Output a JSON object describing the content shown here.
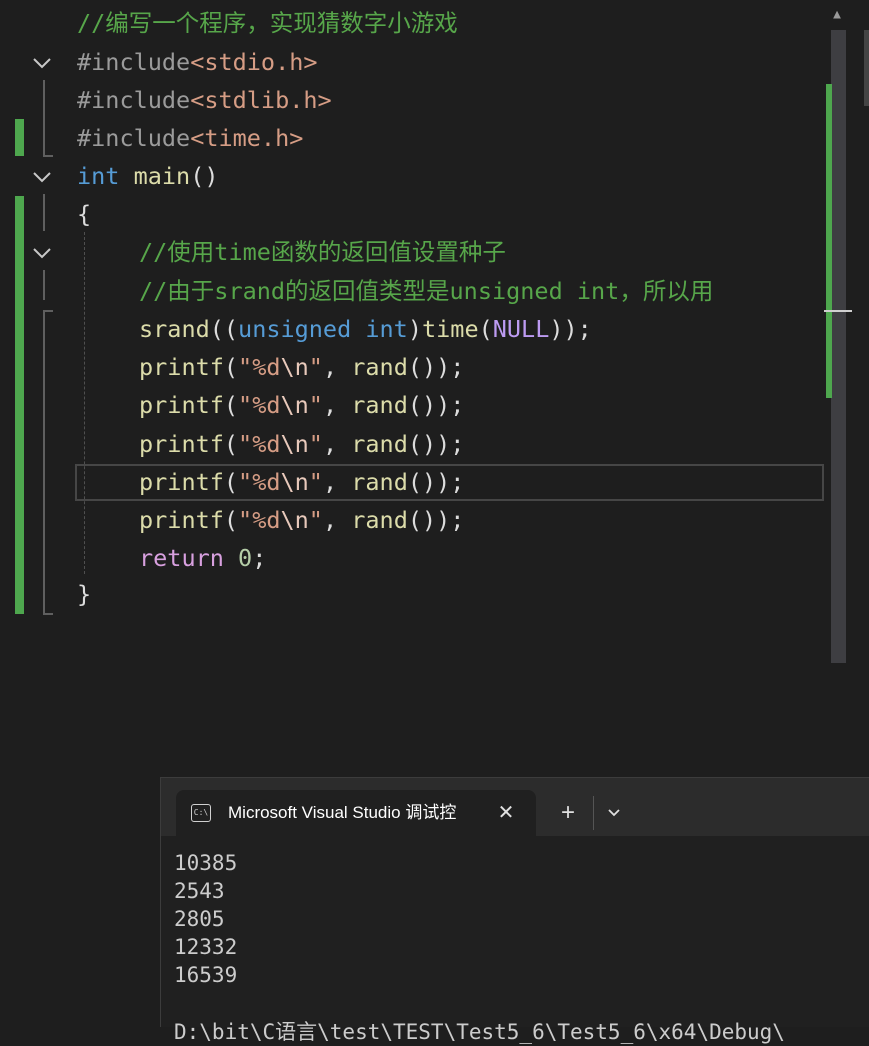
{
  "editor": {
    "lines": [
      {
        "id": "comment-title",
        "text": "//编写一个程序，实现猜数字小游戏"
      },
      {
        "id": "include-stdio",
        "directive": "#include",
        "header": "<stdio.h>"
      },
      {
        "id": "include-stdlib",
        "directive": "#include",
        "header": "<stdlib.h>"
      },
      {
        "id": "include-time",
        "directive": "#include",
        "header": "<time.h>"
      },
      {
        "id": "main-decl",
        "type_kw": "int",
        "name": "main",
        "params": "()"
      },
      {
        "id": "brace-open",
        "text": "{"
      },
      {
        "id": "comment-time",
        "text": "//使用time函数的返回值设置种子"
      },
      {
        "id": "comment-srand",
        "text": "//由于srand的返回值类型是unsigned int，所以用"
      },
      {
        "id": "srand-call",
        "fn": "srand",
        "p1": "((",
        "kw1": "unsigned",
        "kw2": "int",
        "p2": ")",
        "fn2": "time",
        "p3": "(",
        "macro": "NULL",
        "p4": "));"
      },
      {
        "id": "printf-1",
        "fn": "printf",
        "open": "(",
        "str_a": "\"%d",
        "esc": "\\n",
        "str_b": "\"",
        "sep": ", ",
        "call": "rand",
        "close": "());"
      },
      {
        "id": "printf-2",
        "fn": "printf",
        "open": "(",
        "str_a": "\"%d",
        "esc": "\\n",
        "str_b": "\"",
        "sep": ", ",
        "call": "rand",
        "close": "());"
      },
      {
        "id": "printf-3",
        "fn": "printf",
        "open": "(",
        "str_a": "\"%d",
        "esc": "\\n",
        "str_b": "\"",
        "sep": ", ",
        "call": "rand",
        "close": "());"
      },
      {
        "id": "printf-4",
        "fn": "printf",
        "open": "(",
        "str_a": "\"%d",
        "esc": "\\n",
        "str_b": "\"",
        "sep": ", ",
        "call": "rand",
        "close": "());"
      },
      {
        "id": "printf-5",
        "fn": "printf",
        "open": "(",
        "str_a": "\"%d",
        "esc": "\\n",
        "str_b": "\"",
        "sep": ", ",
        "call": "rand",
        "close": "());"
      },
      {
        "id": "return-stmt",
        "kw": "return",
        "value": "0",
        "end": ";"
      },
      {
        "id": "brace-close",
        "text": "}"
      }
    ]
  },
  "terminal": {
    "tab_title": "Microsoft Visual Studio 调试控",
    "tab_icon_text": "C:\\",
    "close_glyph": "✕",
    "new_tab_glyph": "+",
    "output": [
      "10385",
      "2543",
      "2805",
      "12332",
      "16539"
    ],
    "path_partial": "D:\\bit\\C语言\\test\\TEST\\Test5_6\\Test5_6\\x64\\Debug\\"
  },
  "colors": {
    "comment": "#57a64a",
    "keyword": "#569cd6",
    "control_keyword": "#d8a0df",
    "function": "#dcdcaa",
    "string": "#d69d85",
    "macro": "#bd9bf2",
    "change_bar": "#4ea74e"
  }
}
